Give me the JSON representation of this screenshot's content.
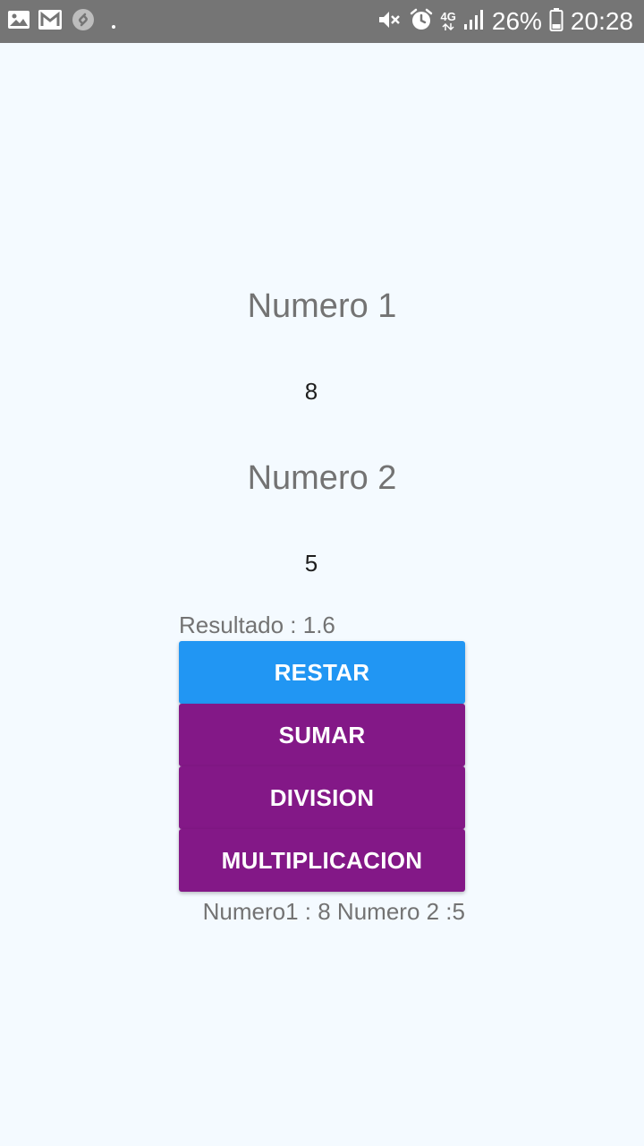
{
  "status_bar": {
    "background": "#757575",
    "left_icons": [
      "image-icon",
      "gmail-icon",
      "shazam-icon",
      "dot-icon"
    ],
    "right_icons": [
      "vibrate-icon",
      "alarm-icon",
      "network-4g-icon",
      "signal-icon",
      "battery-icon"
    ],
    "network_label": "4G",
    "battery_percent": "26%",
    "time": "20:28"
  },
  "screen": {
    "background": "#f4faff",
    "numero1_label": "Numero 1",
    "numero1_value": "8",
    "numero2_label": "Numero 2",
    "numero2_value": "5",
    "result_text": "Resultado : 1.6",
    "buttons": {
      "restar": "RESTAR",
      "sumar": "SUMAR",
      "division": "DIVISION",
      "multiplicacion": "MULTIPLICACION"
    },
    "summary_text": "Numero1 : 8 Numero 2 :5"
  },
  "colors": {
    "restar_button": "#2196f3",
    "operation_buttons": "#831887",
    "label_text": "#737373",
    "value_text": "#1e1e1e"
  }
}
